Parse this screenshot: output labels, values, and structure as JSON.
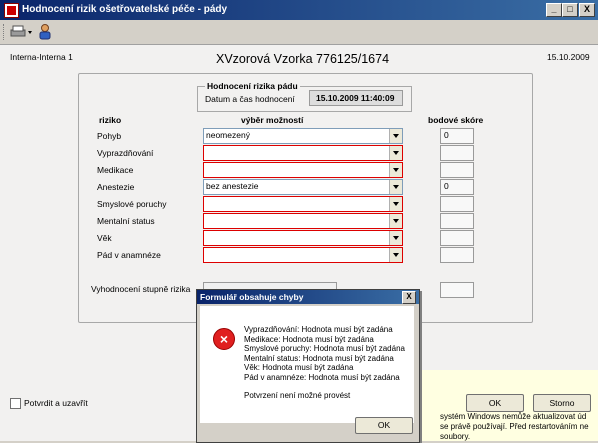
{
  "window": {
    "title": "Hodnocení rizik ošetřovatelské péče - pády",
    "min": "_",
    "max": "□",
    "close": "X"
  },
  "header": {
    "department": "Interna-Interna 1",
    "patient": "XVzorová Vzorka 776125/1674",
    "date": "15.10.2009"
  },
  "group": {
    "title": "Hodnocení rizika pádu",
    "datetime_label": "Datum a čas hodnocení",
    "datetime_value": "15.10.2009 11:40:09"
  },
  "columns": {
    "risk": "riziko",
    "choice": "výběr možností",
    "score": "bodové skóre"
  },
  "rows": [
    {
      "label": "Pohyb",
      "value": "neomezený",
      "score": "0",
      "error": false
    },
    {
      "label": "Vyprazdňování",
      "value": "",
      "score": "",
      "error": true
    },
    {
      "label": "Medikace",
      "value": "",
      "score": "",
      "error": true
    },
    {
      "label": "Anestezie",
      "value": "bez anestezie",
      "score": "0",
      "error": false
    },
    {
      "label": "Smyslové poruchy",
      "value": "",
      "score": "",
      "error": true
    },
    {
      "label": "Mentalní status",
      "value": "",
      "score": "",
      "error": true
    },
    {
      "label": "Věk",
      "value": "",
      "score": "",
      "error": true
    },
    {
      "label": "Pád v anamnéze",
      "value": "",
      "score": "",
      "error": true
    }
  ],
  "evaluation": {
    "label": "Vyhodnocení stupně rizika"
  },
  "footer": {
    "confirm_close": "Potvrdit a uzavřít",
    "ok": "OK",
    "cancel": "Storno"
  },
  "dialog": {
    "title": "Formulář obsahuje chyby",
    "lines": [
      "Vyprazdňování: Hodnota musí být zadána",
      "Medikace: Hodnota musí být zadána",
      "Smyslové poruchy: Hodnota musí být zadána",
      "Mentalní status: Hodnota musí být zadána",
      "Věk: Hodnota musí být zadána",
      "Pád v anamnéze: Hodnota musí být zadána"
    ],
    "footer_text": "Potvrzení není možné provést",
    "ok": "OK",
    "close": "X"
  },
  "background_notification": {
    "lines": [
      "systém Windows nemůže aktualizovat úd",
      "se právě používají. Před restartováním ne",
      "soubory."
    ]
  },
  "colors": {
    "titlebar": "#0a246a",
    "error_border": "#dd0000",
    "error_icon": "#e02020"
  },
  "icons": [
    "app-icon",
    "printer-icon",
    "user-icon",
    "error-icon",
    "checkbox-icon",
    "dropdown-arrow-icon"
  ]
}
